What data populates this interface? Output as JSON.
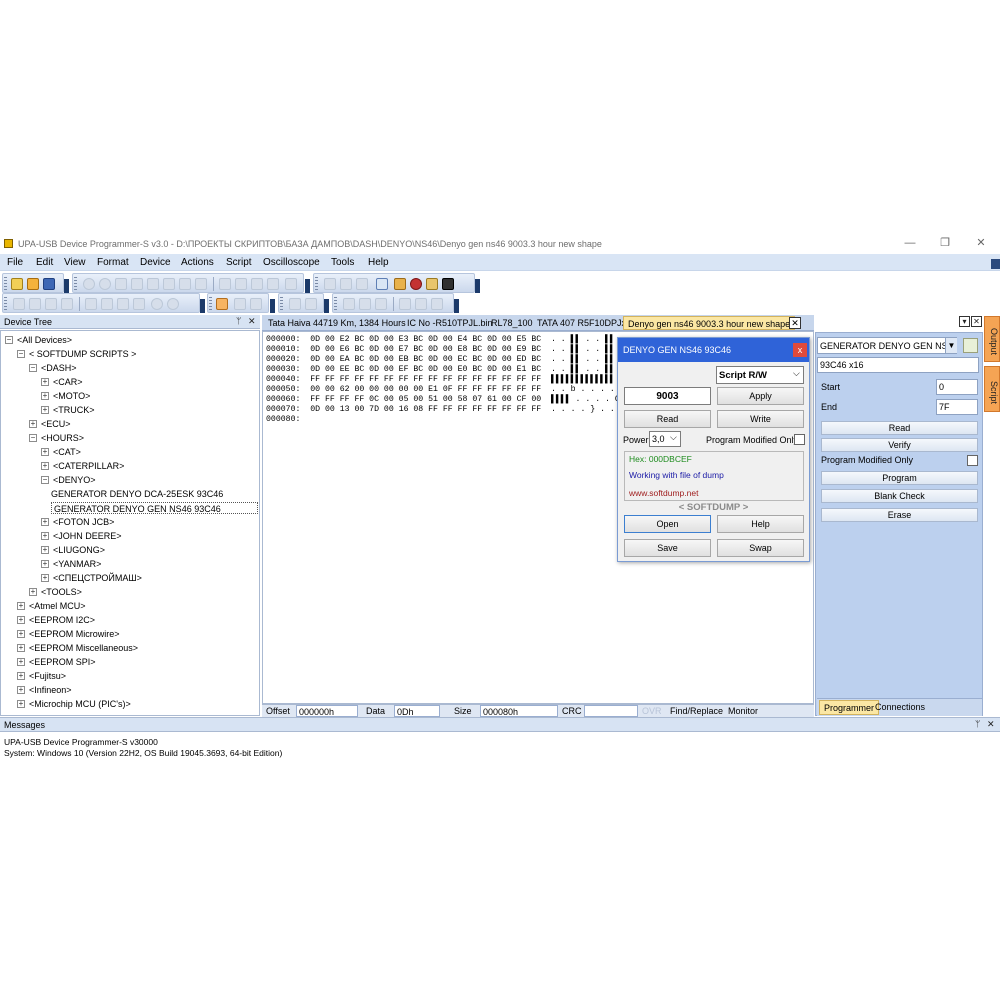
{
  "window": {
    "title": "UPA-USB Device Programmer-S v3.0 - D:\\ПРОЕКТЫ СКРИПТОВ\\БАЗА ДАМПОВ\\DASH\\DENYO\\NS46\\Denyo gen ns46 9003.3 hour new shape",
    "min": "—",
    "max": "❐",
    "close": "✕"
  },
  "menu": [
    "File",
    "Edit",
    "View",
    "Format",
    "Device",
    "Actions",
    "Script",
    "Oscilloscope",
    "Tools",
    "Help"
  ],
  "device_tree": {
    "title": "Device Tree",
    "pin": "ᛘ",
    "close": "✕",
    "nodes": [
      {
        "label": "<All Devices>",
        "lvl": 0,
        "exp": "−"
      },
      {
        "label": "< SOFTDUMP SCRIPTS >",
        "lvl": 1,
        "exp": "−"
      },
      {
        "label": "<DASH>",
        "lvl": 2,
        "exp": "−"
      },
      {
        "label": "<CAR>",
        "lvl": 3,
        "exp": "+"
      },
      {
        "label": "<MOTO>",
        "lvl": 3,
        "exp": "+"
      },
      {
        "label": "<TRUCK>",
        "lvl": 3,
        "exp": "+"
      },
      {
        "label": "<ECU>",
        "lvl": 2,
        "exp": "+"
      },
      {
        "label": "<HOURS>",
        "lvl": 2,
        "exp": "−"
      },
      {
        "label": "<CAT>",
        "lvl": 3,
        "exp": "+"
      },
      {
        "label": "<CATERPILLAR>",
        "lvl": 3,
        "exp": "+"
      },
      {
        "label": "<DENYO>",
        "lvl": 3,
        "exp": "−"
      },
      {
        "label": "GENERATOR DENYO DCA-25ESK 93C46",
        "lvl": 4,
        "exp": ""
      },
      {
        "label": "GENERATOR DENYO GEN NS46 93C46",
        "lvl": 4,
        "exp": "",
        "selected": true
      },
      {
        "label": "<FOTON JCB>",
        "lvl": 3,
        "exp": "+"
      },
      {
        "label": "<JOHN DEERE>",
        "lvl": 3,
        "exp": "+"
      },
      {
        "label": "<LIUGONG>",
        "lvl": 3,
        "exp": "+"
      },
      {
        "label": "<YANMAR>",
        "lvl": 3,
        "exp": "+"
      },
      {
        "label": "<СПЕЦСТРОЙМАШ>",
        "lvl": 3,
        "exp": "+"
      },
      {
        "label": "<TOOLS>",
        "lvl": 2,
        "exp": "+"
      },
      {
        "label": "<Atmel MCU>",
        "lvl": 1,
        "exp": "+"
      },
      {
        "label": "<EEPROM I2C>",
        "lvl": 1,
        "exp": "+"
      },
      {
        "label": "<EEPROM Microwire>",
        "lvl": 1,
        "exp": "+"
      },
      {
        "label": "<EEPROM Miscellaneous>",
        "lvl": 1,
        "exp": "+"
      },
      {
        "label": "<EEPROM SPI>",
        "lvl": 1,
        "exp": "+"
      },
      {
        "label": "<Fujitsu>",
        "lvl": 1,
        "exp": "+"
      },
      {
        "label": "<Infineon>",
        "lvl": 1,
        "exp": "+"
      },
      {
        "label": "<Microchip MCU (PIC's)>",
        "lvl": 1,
        "exp": "+"
      }
    ]
  },
  "tabs": [
    "Tata Haiva 44719 Km, 1384 Hours",
    "IC No -R510TPJL.bin",
    "RL78_100",
    "TATA 407 R5F10DPJx",
    "Denyo gen ns46 9003.3 hour new shape"
  ],
  "tab_close": "✕",
  "hex_lines": [
    "000000:  0D 00 E2 BC 0D 00 E3 BC 0D 00 E4 BC 0D 00 E5 BC  . . ▌▌ . . ▌▌ . .",
    "000010:  0D 00 E6 BC 0D 00 E7 BC 0D 00 E8 BC 0D 00 E9 BC  . . ▌▌ . . ▌▌ . .",
    "000020:  0D 00 EA BC 0D 00 EB BC 0D 00 EC BC 0D 00 ED BC  . . ▌▌ . . ▌▌ . .",
    "000030:  0D 00 EE BC 0D 00 EF BC 0D 00 E0 BC 0D 00 E1 BC  . . ▌▌ . . ▌▌ . .",
    "000040:  FF FF FF FF FF FF FF FF FF FF FF FF FF FF FF FF  ▌▌▌▌▌▌▌▌▌▌▌▌▌",
    "000050:  00 00 62 00 00 00 00 00 E1 0F FF FF FF FF FF FF  . . b . . . . . ▌",
    "000060:  FF FF FF FF 0C 00 05 00 51 00 58 07 61 00 CF 00  ▌▌▌▌ . . . . Q .",
    "000070:  0D 00 13 00 7D 00 16 08 FF FF FF FF FF FF FF FF  . . . . } . . ▌▌",
    "000080:"
  ],
  "hexbar": {
    "offset_label": "Offset",
    "offset": "000000h",
    "data_label": "Data",
    "data": "0Dh",
    "size_label": "Size",
    "size": "000080h",
    "crc_label": "CRC",
    "crc": "",
    "ovr": "OVR",
    "find": "Find/Replace",
    "monitor": "Monitor"
  },
  "dialog": {
    "title": "DENYO GEN NS46 93C46",
    "close": "x",
    "mode": "Script R/W",
    "value": "9003",
    "apply": "Apply",
    "read": "Read",
    "write": "Write",
    "power_label": "Power",
    "power": "3,0",
    "pmo": "Program Modified Only",
    "hex": "Hex: 000DBCEF",
    "working": "Working with file of dump",
    "site": "www.softdump.net",
    "brand": "< SOFTDUMP >",
    "open": "Open",
    "help": "Help",
    "save": "Save",
    "swap": "Swap"
  },
  "programmer": {
    "device": "GENERATOR DENYO GEN NS46",
    "type": "93C46 x16",
    "start_label": "Start",
    "start": "0",
    "end_label": "End",
    "end": "7F",
    "read": "Read",
    "verify": "Verify",
    "pmo": "Program Modified Only",
    "program": "Program",
    "blank": "Blank Check",
    "erase": "Erase",
    "tab1": "Programmer",
    "tab2": "Connections"
  },
  "side_tabs": [
    "Output",
    "Script"
  ],
  "messages": {
    "title": "Messages",
    "pin": "ᛘ",
    "close": "✕",
    "lines": [
      "UPA-USB Device Programmer-S v30000",
      "System: Windows 10 (Version 22H2, OS Build 19045.3693, 64-bit Edition)"
    ]
  }
}
